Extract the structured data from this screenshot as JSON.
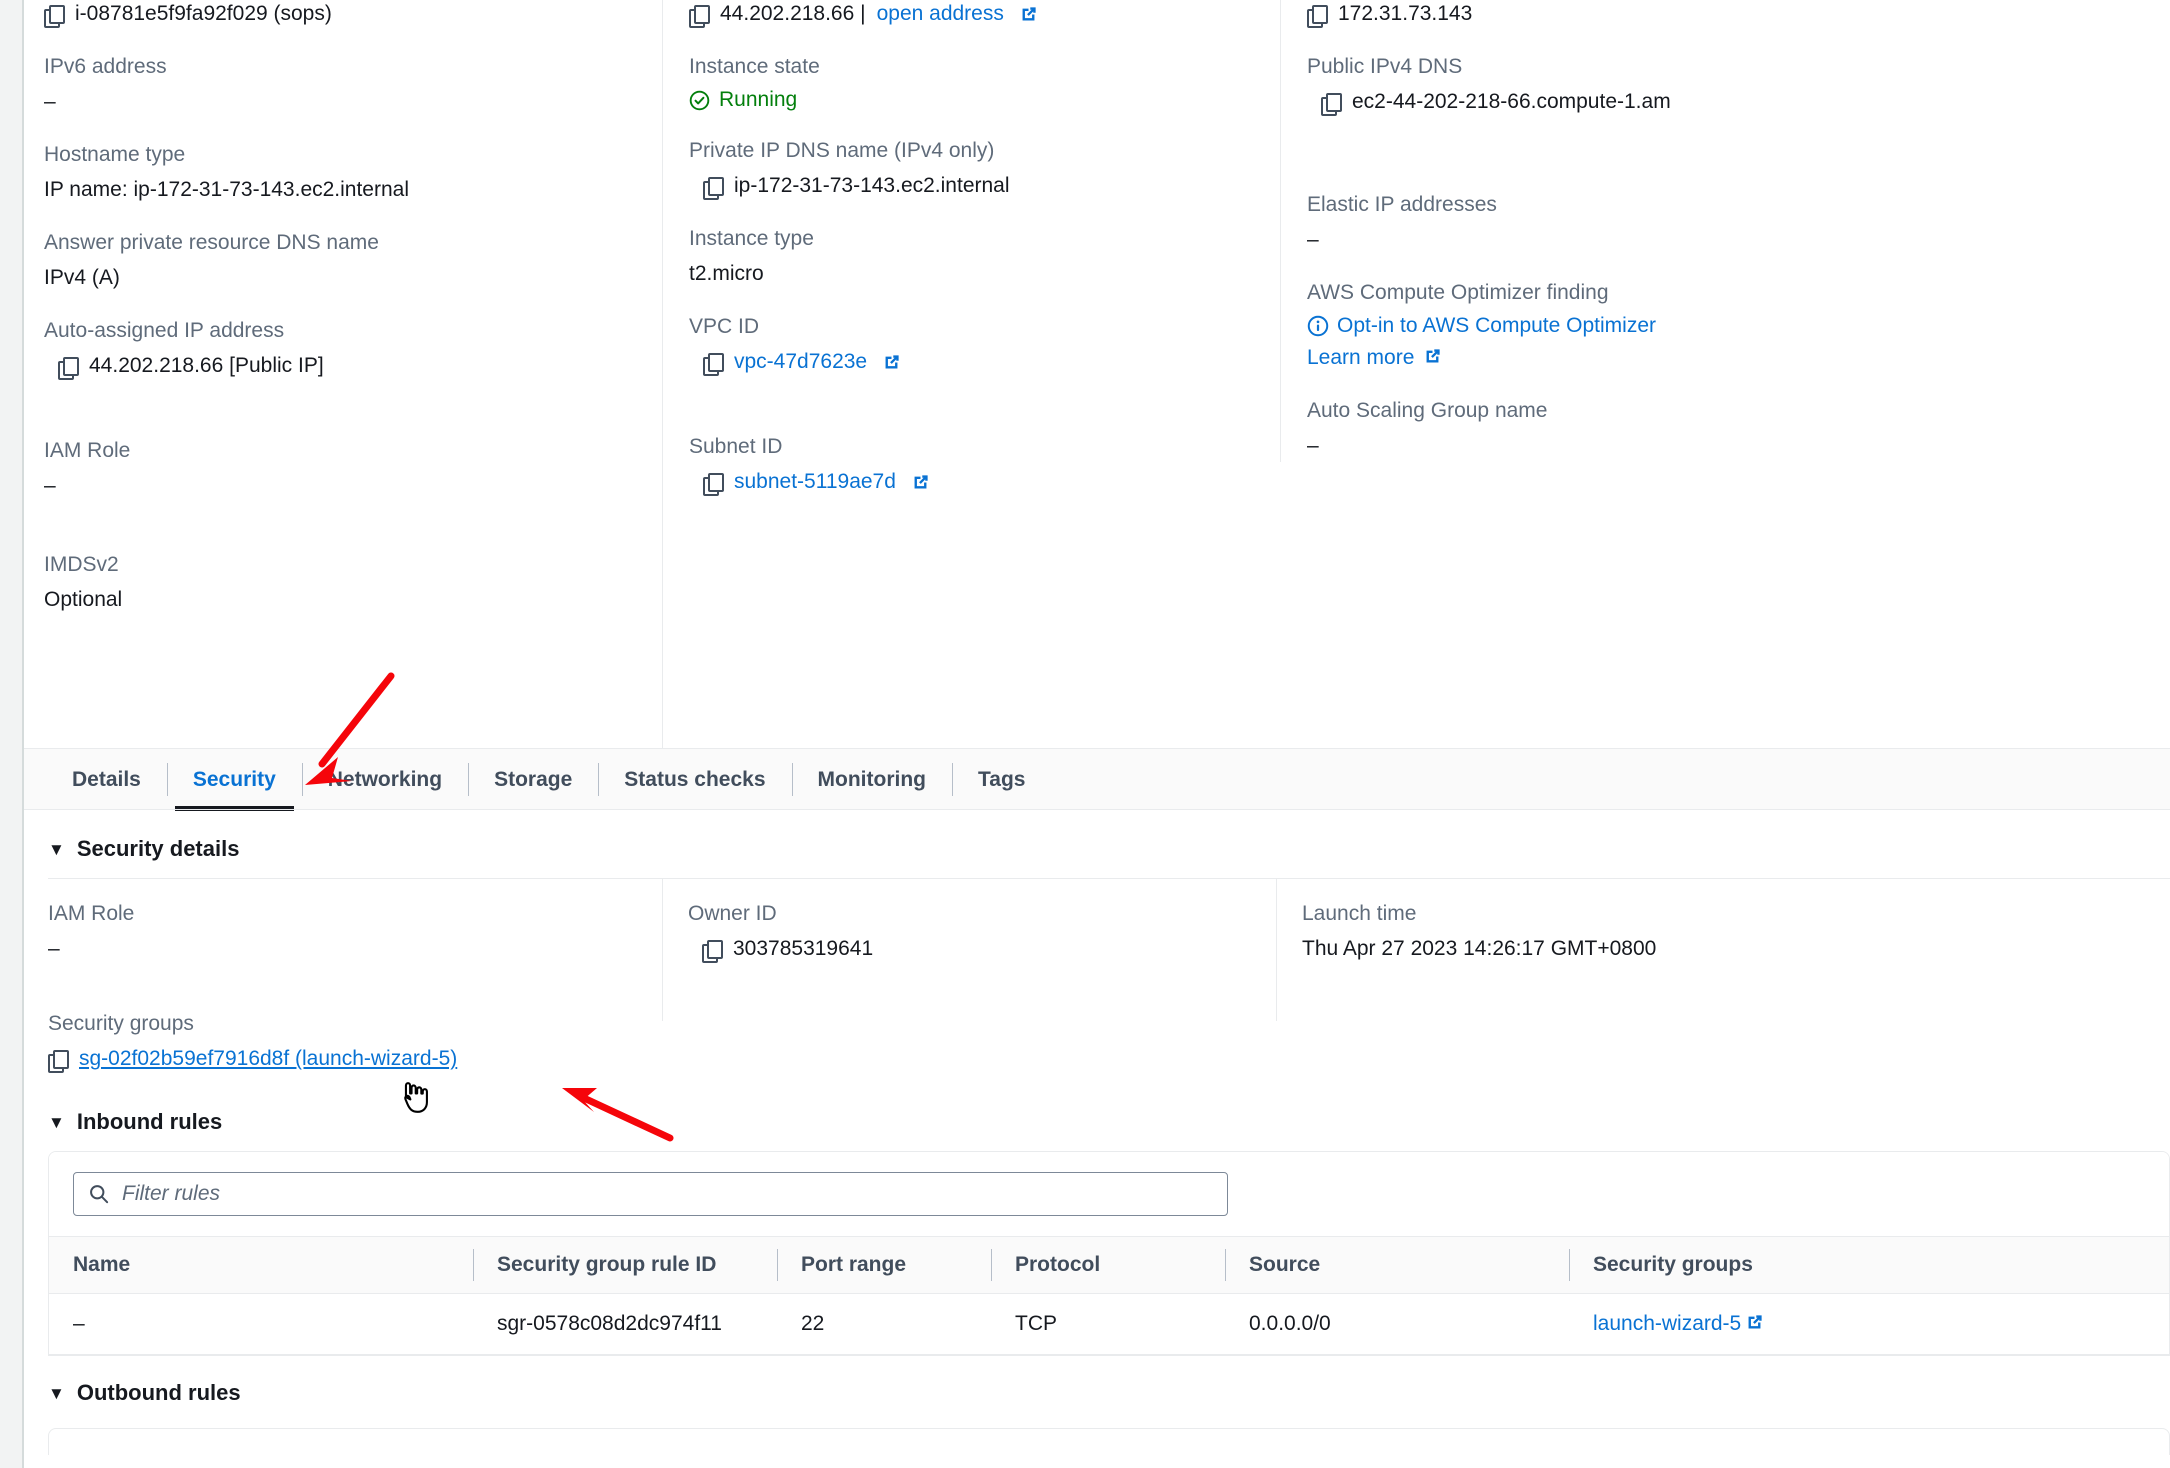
{
  "instance": {
    "id_label": "i-08781e5f9fa92f029 (sops)",
    "public_ipv4_value": "44.202.218.66 |",
    "open_address_link": "open address",
    "private_ipv4_value": "172.31.73.143"
  },
  "columns": {
    "left": [
      {
        "label": "IPv6 address",
        "value": "–",
        "type": "plain"
      },
      {
        "label": "Hostname type",
        "value": "IP name: ip-172-31-73-143.ec2.internal",
        "type": "plain"
      },
      {
        "label": "Answer private resource DNS name",
        "value": "IPv4 (A)",
        "type": "plain"
      },
      {
        "label": "Auto-assigned IP address",
        "value": "44.202.218.66 [Public IP]",
        "type": "copy"
      },
      {
        "label": "IAM Role",
        "value": "–",
        "type": "plain"
      },
      {
        "label": "IMDSv2",
        "value": "Optional",
        "type": "plain"
      }
    ],
    "middle": [
      {
        "label": "Instance state",
        "value": "Running",
        "type": "state"
      },
      {
        "label": "Private IP DNS name (IPv4 only)",
        "value": "ip-172-31-73-143.ec2.internal",
        "type": "copy"
      },
      {
        "label": "Instance type",
        "value": "t2.micro",
        "type": "plain"
      },
      {
        "label": "VPC ID",
        "value": "vpc-47d7623e",
        "type": "copylink"
      },
      {
        "label": "Subnet ID",
        "value": "subnet-5119ae7d",
        "type": "copylink"
      }
    ],
    "right": [
      {
        "label": "Public IPv4 DNS",
        "value": "ec2-44-202-218-66.compute-1.am",
        "type": "copy"
      },
      {
        "label": "Elastic IP addresses",
        "value": "–",
        "type": "plain"
      },
      {
        "label": "AWS Compute Optimizer finding",
        "value": "Opt-in to AWS Compute Optimizer",
        "type": "optimizer",
        "extra": "Learn more"
      },
      {
        "label": "Auto Scaling Group name",
        "value": "–",
        "type": "plain"
      }
    ]
  },
  "tabs": [
    {
      "label": "Details",
      "active": false
    },
    {
      "label": "Security",
      "active": true
    },
    {
      "label": "Networking",
      "active": false
    },
    {
      "label": "Storage",
      "active": false
    },
    {
      "label": "Status checks",
      "active": false
    },
    {
      "label": "Monitoring",
      "active": false
    },
    {
      "label": "Tags",
      "active": false
    }
  ],
  "security_details": {
    "title": "Security details",
    "caret": "▼",
    "iam_role_label": "IAM Role",
    "iam_role_value": "–",
    "owner_id_label": "Owner ID",
    "owner_id_value": "303785319641",
    "launch_time_label": "Launch time",
    "launch_time_value": "Thu Apr 27 2023 14:26:17 GMT+0800",
    "security_groups_label": "Security groups",
    "security_groups_value": "sg-02f02b59ef7916d8f (launch-wizard-5)"
  },
  "inbound_rules": {
    "title": "Inbound rules",
    "caret": "▼",
    "filter_placeholder": "Filter rules",
    "filter_value": "",
    "columns": [
      "Name",
      "Security group rule ID",
      "Port range",
      "Protocol",
      "Source",
      "Security groups"
    ],
    "rows": [
      {
        "name": "–",
        "rule_id": "sgr-0578c08d2dc974f11",
        "port_range": "22",
        "protocol": "TCP",
        "source": "0.0.0.0/0",
        "security_groups": "launch-wizard-5"
      }
    ]
  },
  "outbound_rules": {
    "title": "Outbound rules",
    "caret": "▼"
  },
  "colors": {
    "link": "#0972d3",
    "running": "#037f0c",
    "label": "#5f6b7a",
    "text": "#16191f",
    "annotation_arrow": "#f5050a"
  },
  "icons": {
    "copy": "copy-icon",
    "external_link": "external-link-icon",
    "status_running": "check-circle-icon",
    "info": "info-circle-icon",
    "search": "search-icon",
    "cursor": "pointer-hand-cursor"
  }
}
